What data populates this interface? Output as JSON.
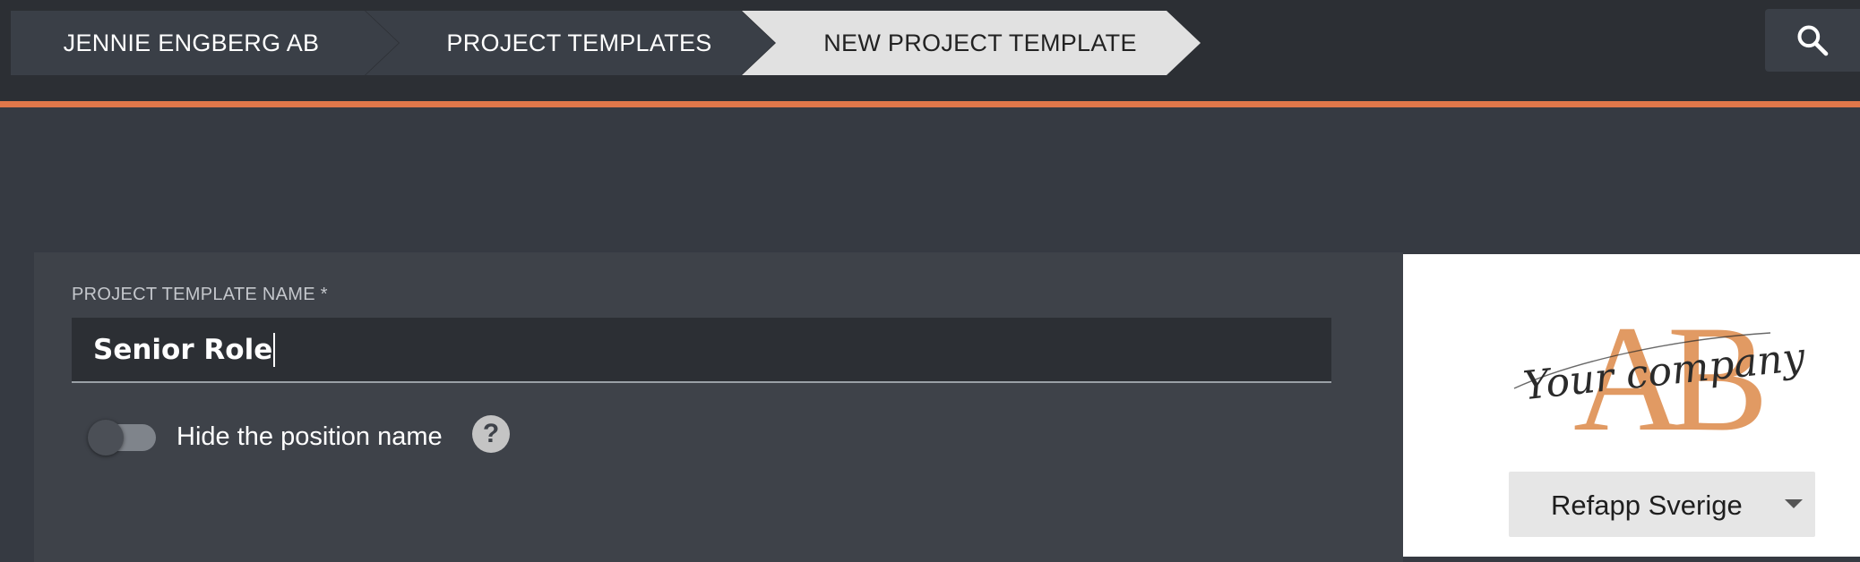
{
  "breadcrumb": {
    "items": [
      {
        "label": "JENNIE ENGBERG AB"
      },
      {
        "label": "PROJECT TEMPLATES"
      },
      {
        "label": "NEW PROJECT TEMPLATE"
      }
    ]
  },
  "header": {
    "search_icon": "search-icon"
  },
  "colors": {
    "accent": "#e0774a",
    "topbar": "#2c2f34",
    "background": "#363a42",
    "card": "#3e4249",
    "logo_accent": "#e19a63"
  },
  "form": {
    "name_label": "PROJECT TEMPLATE NAME *",
    "name_value": "Senior Role",
    "hide_position_label": "Hide the position name",
    "hide_position_on": false,
    "help_glyph": "?"
  },
  "logo": {
    "monogram": "AB",
    "script_text": "Your company"
  },
  "company_select": {
    "selected": "Refapp Sverige"
  }
}
